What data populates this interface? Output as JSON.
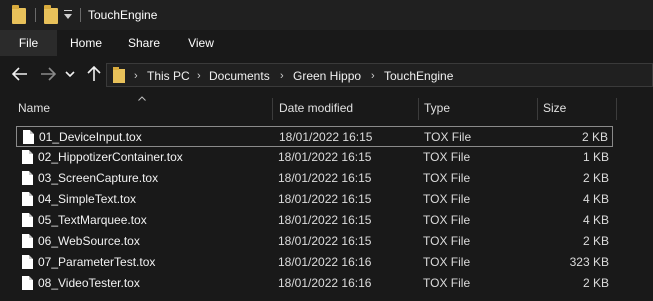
{
  "titlebar": {
    "title": "TouchEngine"
  },
  "ribbon": {
    "tabs": [
      "File",
      "Home",
      "Share",
      "View"
    ]
  },
  "address": {
    "crumbs": [
      "This PC",
      "Documents",
      "Green Hippo",
      "TouchEngine"
    ]
  },
  "columns": {
    "name": "Name",
    "date": "Date modified",
    "type": "Type",
    "size": "Size"
  },
  "files": [
    {
      "name": "01_DeviceInput.tox",
      "date": "18/01/2022 16:15",
      "type": "TOX File",
      "size": "2 KB"
    },
    {
      "name": "02_HippotizerContainer.tox",
      "date": "18/01/2022 16:15",
      "type": "TOX File",
      "size": "1 KB"
    },
    {
      "name": "03_ScreenCapture.tox",
      "date": "18/01/2022 16:15",
      "type": "TOX File",
      "size": "2 KB"
    },
    {
      "name": "04_SimpleText.tox",
      "date": "18/01/2022 16:15",
      "type": "TOX File",
      "size": "4 KB"
    },
    {
      "name": "05_TextMarquee.tox",
      "date": "18/01/2022 16:15",
      "type": "TOX File",
      "size": "4 KB"
    },
    {
      "name": "06_WebSource.tox",
      "date": "18/01/2022 16:15",
      "type": "TOX File",
      "size": "2 KB"
    },
    {
      "name": "07_ParameterTest.tox",
      "date": "18/01/2022 16:16",
      "type": "TOX File",
      "size": "323 KB"
    },
    {
      "name": "08_VideoTester.tox",
      "date": "18/01/2022 16:16",
      "type": "TOX File",
      "size": "2 KB"
    }
  ],
  "icons": {
    "folder": "folder-icon",
    "file": "file-icon",
    "back": "arrow-left-icon",
    "forward": "arrow-right-icon",
    "recent": "chevron-down-icon",
    "up": "arrow-up-icon",
    "breadcrumb_separator": "chevron-right-icon"
  },
  "colors": {
    "background": "#191919",
    "titlebar": "#202020",
    "folder": "#e8c15a",
    "text": "#e6e6e6"
  }
}
